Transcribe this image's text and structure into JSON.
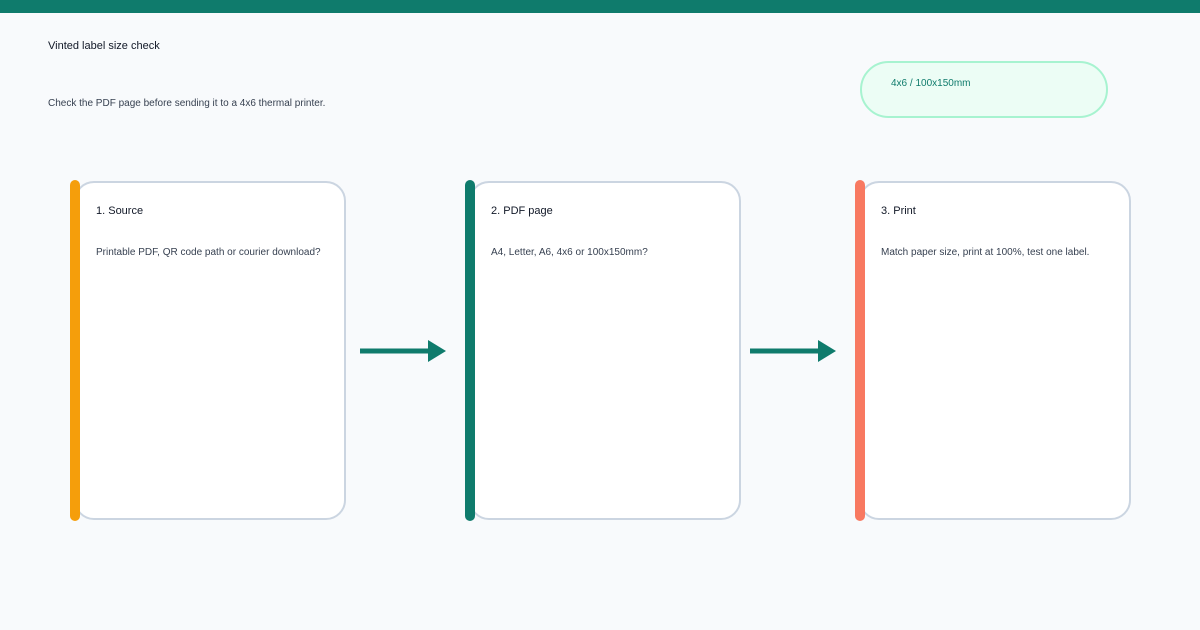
{
  "header": {
    "title": "Vinted label size check",
    "subtitle": "Check the PDF page before sending it to a 4x6 thermal printer.",
    "size_badge": "4x6 / 100x150mm"
  },
  "colors": {
    "brand": "#0f7b6c",
    "source_accent": "#f59e0b",
    "pdf_accent": "#0f7b6c",
    "print_accent": "#f87961",
    "badge_bg": "#ecfdf5",
    "badge_border": "#a7f3d0"
  },
  "steps": [
    {
      "title": "1. Source",
      "description": "Printable PDF, QR code path or courier download?"
    },
    {
      "title": "2. PDF page",
      "description": "A4, Letter, A6, 4x6 or 100x150mm?"
    },
    {
      "title": "3. Print",
      "description": "Match paper size, print at 100%, test one label."
    }
  ],
  "connectors": [
    {
      "from": "1. Source",
      "to": "2. PDF page",
      "icon": "arrow-right-icon"
    },
    {
      "from": "2. PDF page",
      "to": "3. Print",
      "icon": "arrow-right-icon"
    }
  ]
}
